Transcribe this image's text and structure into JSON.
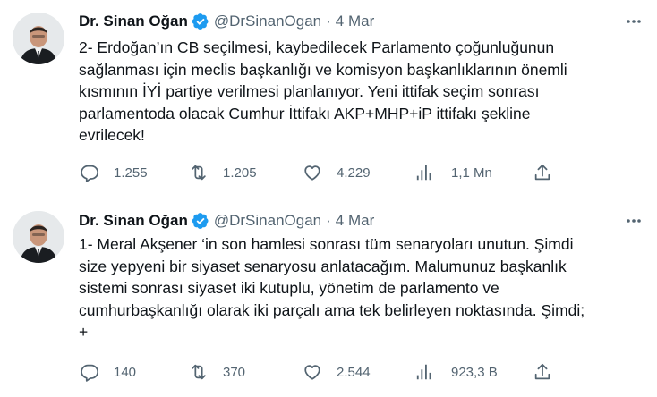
{
  "tweets": [
    {
      "author_name": "Dr. Sinan Oğan",
      "handle": "@DrSinanOgan",
      "separator": "·",
      "date": "4 Mar",
      "text_lines": [
        "2- Erdoğan’ın CB seçilmesi, kaybedilecek Parlamento çoğunluğunun",
        "sağlanması için meclis başkanlığı ve komisyon başkanlıklarının önemli",
        "kısmının İYİ partiye verilmesi planlanıyor. Yeni ittifak seçim sonrası",
        "parlamentoda olacak Cumhur İttifakı AKP+MHP+iP ittifakı şekline",
        "evrilecek!"
      ],
      "replies": "1.255",
      "retweets": "1.205",
      "likes": "4.229",
      "views": "1,1 Mn"
    },
    {
      "author_name": "Dr. Sinan Oğan",
      "handle": "@DrSinanOgan",
      "separator": "·",
      "date": "4 Mar",
      "text_lines": [
        "1- Meral Akşener ‘in son hamlesi sonrası tüm senaryoları unutun. Şimdi",
        "size yepyeni bir siyaset senaryosu anlatacağım. Malumunuz başkanlık",
        "sistemi sonrası siyaset iki kutuplu, yönetim de parlamento ve",
        "cumhurbaşkanlığı olarak iki parçalı ama tek belirleyen noktasında. Şimdi;",
        "+"
      ],
      "replies": "140",
      "retweets": "370",
      "likes": "2.544",
      "views": "923,3 B"
    }
  ],
  "icons": {
    "verified": "verified-badge-icon",
    "more": "more-options-icon",
    "reply": "reply-icon",
    "retweet": "retweet-icon",
    "like": "heart-icon",
    "views": "views-chart-icon",
    "share": "share-icon"
  },
  "colors": {
    "text": "#0f1419",
    "secondary": "#536471",
    "verified": "#1d9bf0",
    "divider": "#eff3f4"
  }
}
